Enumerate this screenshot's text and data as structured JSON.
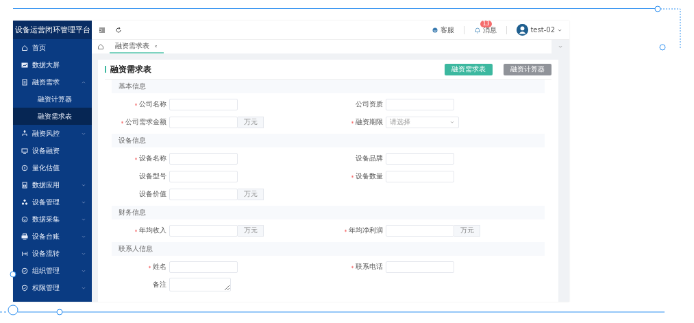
{
  "app": {
    "title": "设备运营闭环管理平台"
  },
  "sidebar": {
    "items": [
      {
        "label": "首页",
        "selected": false
      },
      {
        "label": "数据大屏",
        "selected": false
      },
      {
        "label": "融资需求",
        "selected": false,
        "expanded": true,
        "children": [
          {
            "label": "融资计算器",
            "selected": false
          },
          {
            "label": "融资需求表",
            "selected": true
          }
        ]
      },
      {
        "label": "融资风控",
        "selected": false,
        "expanded": false
      },
      {
        "label": "设备融资",
        "selected": false
      },
      {
        "label": "量化估值",
        "selected": false
      },
      {
        "label": "数据应用",
        "selected": false,
        "expanded": false
      },
      {
        "label": "设备管理",
        "selected": false,
        "expanded": false
      },
      {
        "label": "数据采集",
        "selected": false,
        "expanded": false
      },
      {
        "label": "设备台账",
        "selected": false,
        "expanded": false
      },
      {
        "label": "设备流转",
        "selected": false,
        "expanded": false
      },
      {
        "label": "组织管理",
        "selected": false,
        "expanded": false
      },
      {
        "label": "权限管理",
        "selected": false,
        "expanded": false
      }
    ]
  },
  "header": {
    "service": "客服",
    "messages": "消息",
    "message_badge": "13",
    "user": "test-02"
  },
  "tabs": [
    {
      "label": "融资需求表",
      "selected": true
    }
  ],
  "page": {
    "title": "融资需求表",
    "buttons": [
      {
        "label": "融资需求表",
        "kind": "primary"
      },
      {
        "label": "融资计算器",
        "kind": "secondary"
      }
    ],
    "sections": [
      {
        "title": "基本信息",
        "fields": [
          {
            "label": "公司名称",
            "required": true,
            "kind": "text"
          },
          {
            "label": "公司资质",
            "required": false,
            "kind": "text"
          },
          {
            "label": "公司需求金额",
            "required": true,
            "kind": "unit",
            "unit": "万元"
          },
          {
            "label": "融资期限",
            "required": true,
            "kind": "select",
            "placeholder": "请选择"
          }
        ]
      },
      {
        "title": "设备信息",
        "fields": [
          {
            "label": "设备名称",
            "required": true,
            "kind": "text"
          },
          {
            "label": "设备品牌",
            "required": false,
            "kind": "text"
          },
          {
            "label": "设备型号",
            "required": false,
            "kind": "text"
          },
          {
            "label": "设备数量",
            "required": true,
            "kind": "text"
          },
          {
            "label": "设备价值",
            "required": false,
            "kind": "unit",
            "unit": "万元"
          }
        ]
      },
      {
        "title": "财务信息",
        "fields": [
          {
            "label": "年均收入",
            "required": true,
            "kind": "unit",
            "unit": "万元"
          },
          {
            "label": "年均净利润",
            "required": true,
            "kind": "unit",
            "unit": "万元"
          }
        ]
      },
      {
        "title": "联系人信息",
        "fields": [
          {
            "label": "姓名",
            "required": true,
            "kind": "text"
          },
          {
            "label": "联系电话",
            "required": true,
            "kind": "text"
          },
          {
            "label": "备注",
            "required": false,
            "kind": "textarea"
          }
        ]
      }
    ]
  }
}
